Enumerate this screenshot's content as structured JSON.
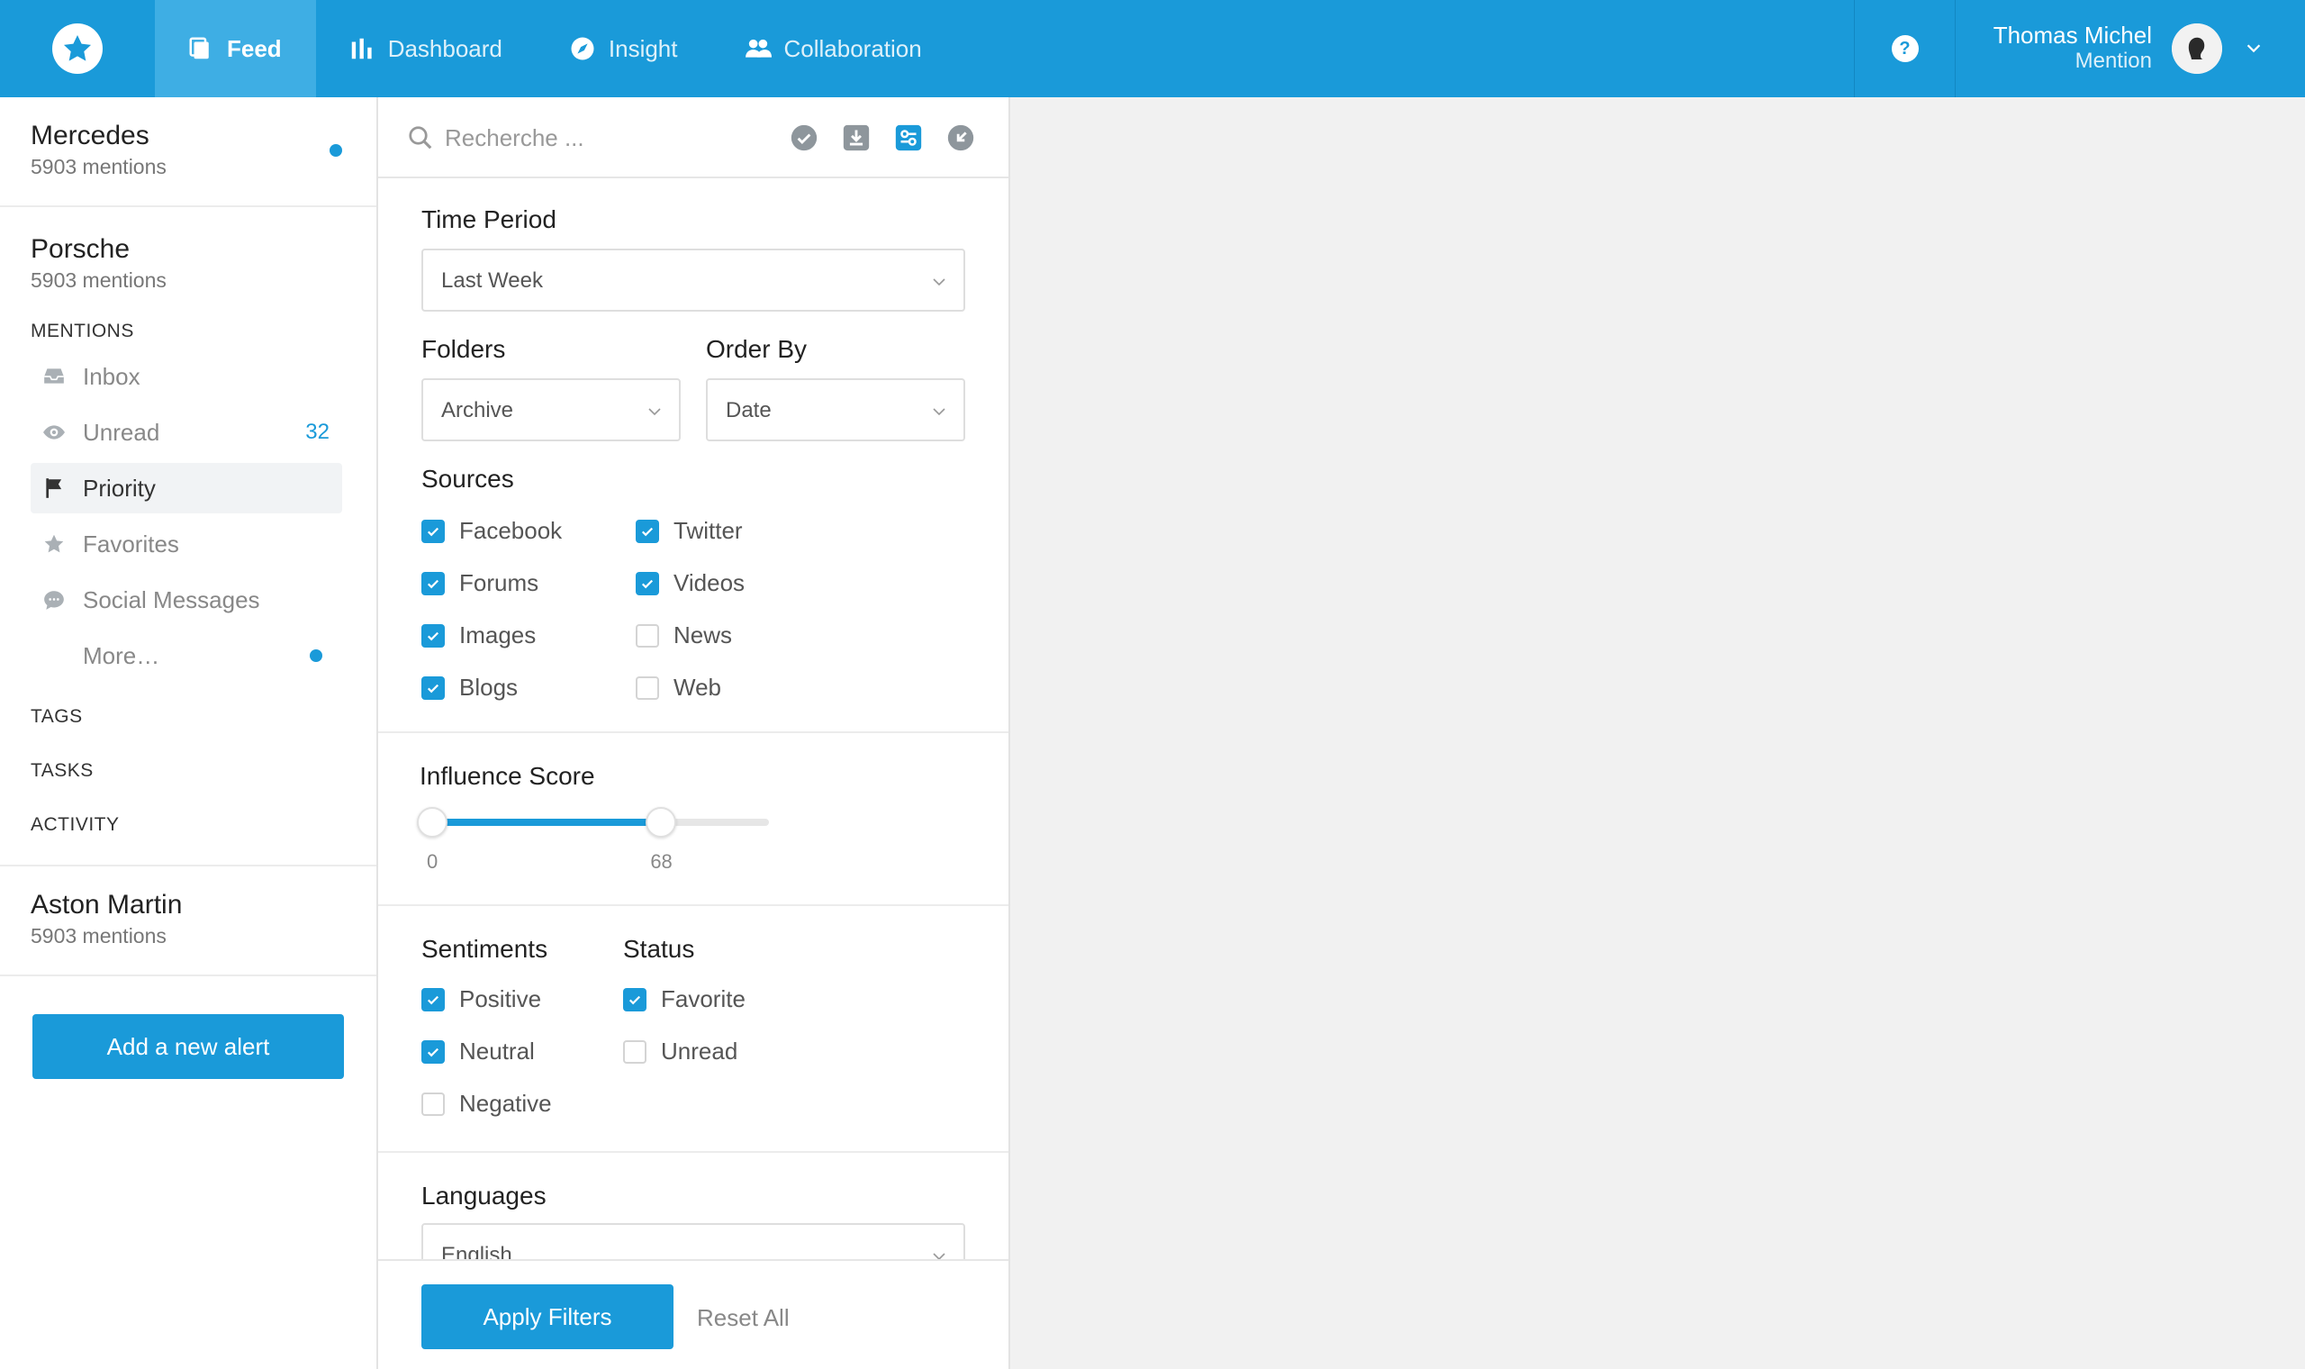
{
  "colors": {
    "primary": "#1a9ad9",
    "active_nav": "#3eaee4",
    "background": "#f1f1f1"
  },
  "header": {
    "logo_icon": "star-icon",
    "nav": [
      {
        "label": "Feed",
        "icon": "feed-icon",
        "active": true
      },
      {
        "label": "Dashboard",
        "icon": "bar-chart-icon",
        "active": false
      },
      {
        "label": "Insight",
        "icon": "compass-icon",
        "active": false
      },
      {
        "label": "Collaboration",
        "icon": "users-icon",
        "active": false
      }
    ],
    "help_label": "?",
    "user": {
      "name": "Thomas Michel",
      "subtitle": "Mention"
    }
  },
  "sidebar": {
    "alerts": [
      {
        "name": "Mercedes",
        "count": "5903 mentions",
        "unread_dot": true
      },
      {
        "name": "Porsche",
        "count": "5903 mentions"
      },
      {
        "name": "Aston Martin",
        "count": "5903 mentions"
      }
    ],
    "mentions_title": "MENTIONS",
    "menu": [
      {
        "label": "Inbox",
        "icon": "inbox-icon"
      },
      {
        "label": "Unread",
        "icon": "eye-icon",
        "badge": "32"
      },
      {
        "label": "Priority",
        "icon": "flag-icon",
        "selected": true
      },
      {
        "label": "Favorites",
        "icon": "star-icon"
      },
      {
        "label": "Social Messages",
        "icon": "chat-bubble-icon"
      },
      {
        "label": "More…",
        "dot": true
      }
    ],
    "sections": [
      "TAGS",
      "TASKS",
      "ACTIVITY"
    ],
    "add_alert_label": "Add a new alert"
  },
  "filters": {
    "search_placeholder": "Recherche ...",
    "tools": [
      "check-circle-icon",
      "download-icon",
      "filter-settings-icon",
      "collapse-icon"
    ],
    "time_period": {
      "label": "Time Period",
      "value": "Last Week"
    },
    "folders": {
      "label": "Folders",
      "value": "Archive"
    },
    "order_by": {
      "label": "Order By",
      "value": "Date"
    },
    "sources": {
      "label": "Sources",
      "items": [
        {
          "label": "Facebook",
          "checked": true
        },
        {
          "label": "Forums",
          "checked": true
        },
        {
          "label": "Images",
          "checked": true
        },
        {
          "label": "Blogs",
          "checked": true
        },
        {
          "label": "Twitter",
          "checked": true
        },
        {
          "label": "Videos",
          "checked": true
        },
        {
          "label": "News",
          "checked": false
        },
        {
          "label": "Web",
          "checked": false
        }
      ]
    },
    "influence": {
      "label": "Influence Score",
      "min": 0,
      "max": 100,
      "low": "0",
      "high": "68"
    },
    "sentiments": {
      "label": "Sentiments",
      "items": [
        {
          "label": "Positive",
          "checked": true
        },
        {
          "label": "Neutral",
          "checked": true
        },
        {
          "label": "Negative",
          "checked": false
        }
      ]
    },
    "status": {
      "label": "Status",
      "items": [
        {
          "label": "Favorite",
          "checked": true
        },
        {
          "label": "Unread",
          "checked": false
        }
      ]
    },
    "languages": {
      "label": "Languages",
      "value": "English"
    },
    "apply_label": "Apply Filters",
    "reset_label": "Reset All"
  }
}
